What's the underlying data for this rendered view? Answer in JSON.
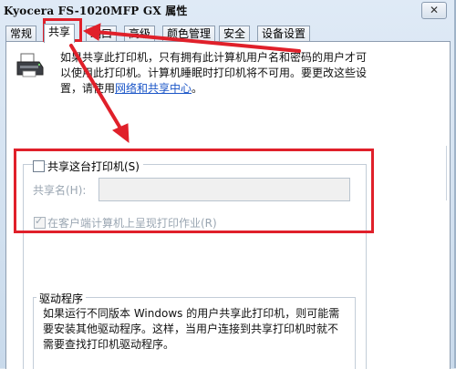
{
  "window": {
    "title": "Kyocera FS-1020MFP GX 属性",
    "close_glyph": "✕"
  },
  "tabs": [
    {
      "label": "常规",
      "active": false
    },
    {
      "label": "共享",
      "active": true
    },
    {
      "label": "端口",
      "active": false
    },
    {
      "label": "高级",
      "active": false
    },
    {
      "label": "颜色管理",
      "active": false
    },
    {
      "label": "安全",
      "active": false
    },
    {
      "label": "设备设置",
      "active": false
    }
  ],
  "intro": {
    "text": "如果共享此打印机，只有拥有此计算机用户名和密码的用户才可以使用此打印机。计算机睡眠时打印机将不可用。要更改这些设置，请使用",
    "link": "网络和共享中心",
    "suffix": "。"
  },
  "share": {
    "checkbox_label": "共享这台打印机(S)",
    "checked": false,
    "name_label": "共享名(H):",
    "name_value": "",
    "render_label": "在客户端计算机上呈现打印作业(R)",
    "render_checked": true
  },
  "drivers": {
    "title": "驱动程序",
    "text": "如果运行不同版本 Windows 的用户共享此打印机，则可能需要安装其他驱动程序。这样，当用户连接到共享打印机时就不需要查找打印机驱动程序。"
  },
  "annotation": {
    "color": "#e0202a"
  }
}
